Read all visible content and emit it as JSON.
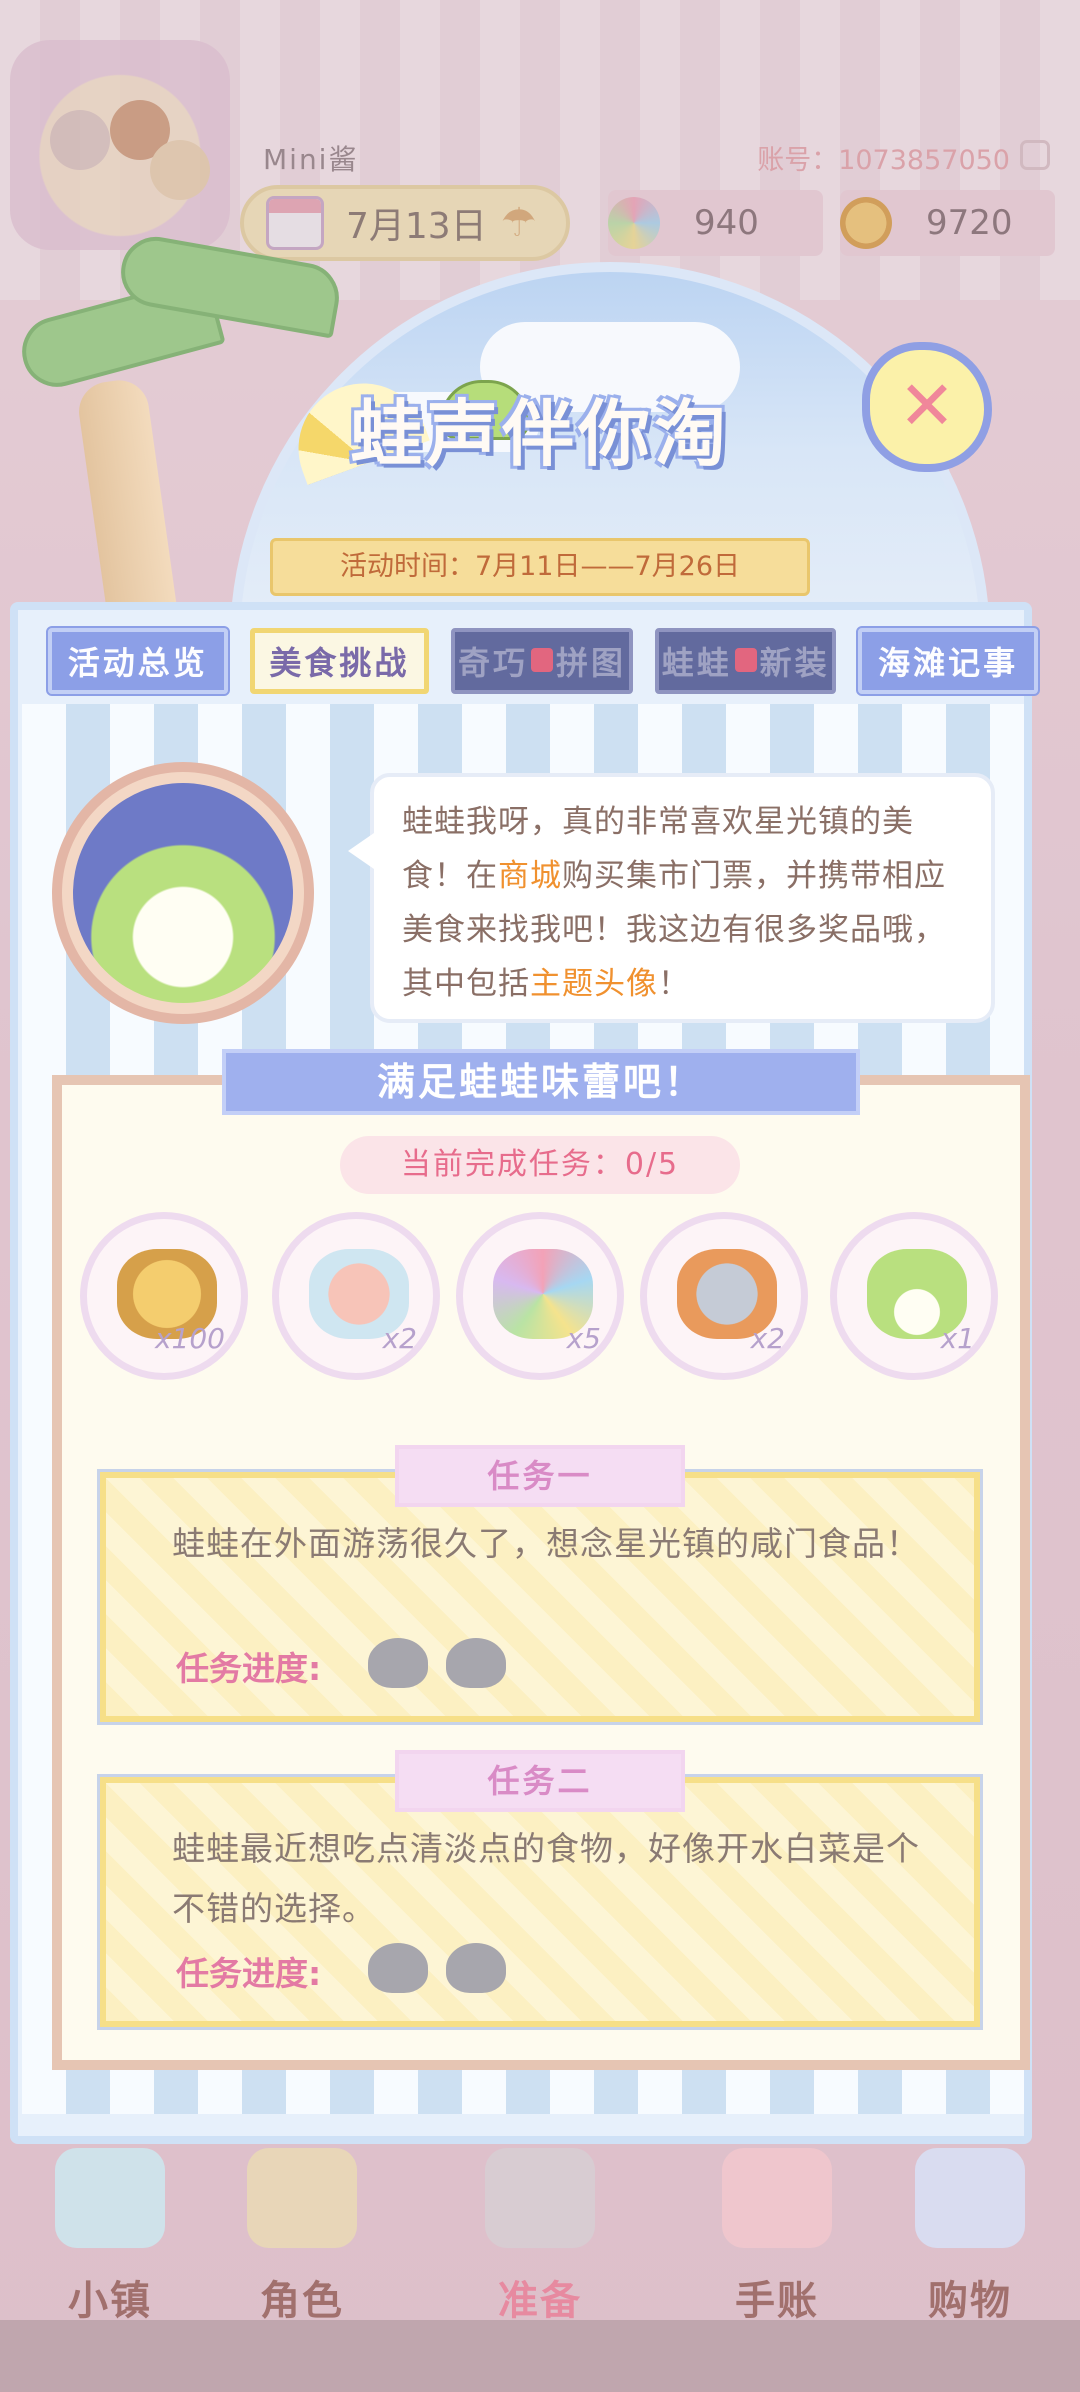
{
  "header": {
    "username": "Mini酱",
    "account": "账号：1073857050",
    "date": "7月13日",
    "flowers": "940",
    "coins": "9720"
  },
  "banner": {
    "title": "蛙声伴你淘",
    "activity_time": "活动时间：7月11日——7月26日"
  },
  "tabs": [
    {
      "label": "活动总览",
      "state": "normal"
    },
    {
      "label": "美食挑战",
      "state": "active"
    },
    {
      "label": "奇巧拼图",
      "state": "locked"
    },
    {
      "label": "蛙蛙新装",
      "state": "locked"
    },
    {
      "label": "海滩记事",
      "state": "normal"
    }
  ],
  "speech": {
    "part1": "蛙蛙我呀，真的非常喜欢星光镇的美食！在",
    "highlight1": "商城",
    "part2": "购买集市门票，并携带相应美食来找我吧！我这边有很多奖品哦，其中包括",
    "highlight2": "主题头像",
    "part3": "！"
  },
  "tasks_section": {
    "title": "满足蛙蛙味蕾吧！",
    "progress": "当前完成任务：0/5"
  },
  "rewards": [
    {
      "icon": "gold-coins-icon",
      "qty": "x100"
    },
    {
      "icon": "shrimp-dish-icon",
      "qty": "x2"
    },
    {
      "icon": "rainbow-flower-icon",
      "qty": "x5"
    },
    {
      "icon": "fish-can-icon",
      "qty": "x2"
    },
    {
      "icon": "frog-avatar-icon",
      "qty": "x1"
    }
  ],
  "tasks": [
    {
      "label": "任务一",
      "text": "蛙蛙在外面游荡很久了，想念星光镇的咸门食品！",
      "progress_label": "任务进度:"
    },
    {
      "label": "任务二",
      "text": "蛙蛙最近想吃点清淡点的食物，好像开水白菜是个不错的选择。",
      "progress_label": "任务进度:"
    }
  ],
  "bottom_nav": [
    {
      "label": "小镇",
      "icon": "map-icon"
    },
    {
      "label": "角色",
      "icon": "character-icon"
    },
    {
      "label": "准备",
      "icon": "prepare-icon"
    },
    {
      "label": "手账",
      "icon": "notebook-icon"
    },
    {
      "label": "购物",
      "icon": "shopping-bag-icon"
    }
  ],
  "colors": {
    "tab_normal": "#8c9fe7",
    "tab_active_border": "#f1d673",
    "tab_locked": "#626a9e",
    "highlight": "#f0912f",
    "progress_pink": "#e76c8c"
  }
}
